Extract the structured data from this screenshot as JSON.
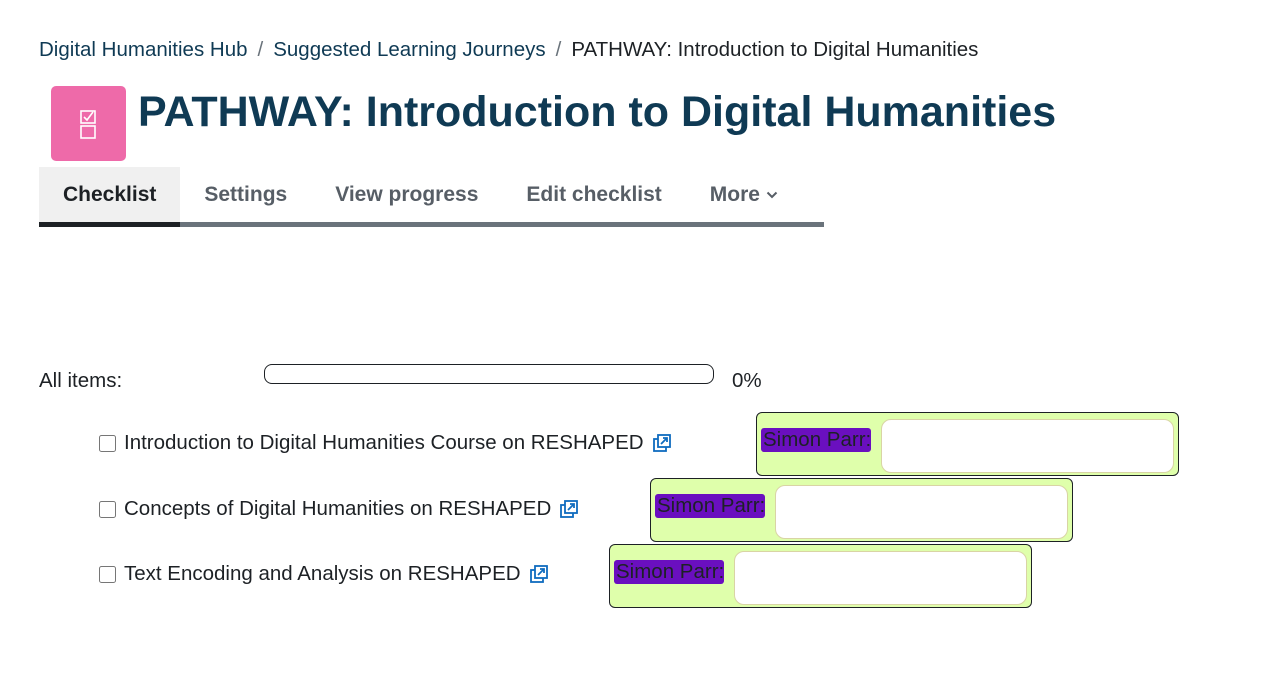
{
  "breadcrumb": {
    "items": [
      "Digital Humanities Hub",
      "Suggested Learning Journeys",
      "PATHWAY: Introduction to Digital Humanities"
    ],
    "separator": "/"
  },
  "header": {
    "title": "PATHWAY: Introduction to Digital Humanities",
    "icon": "checklist-icon",
    "icon_color": "#ee6aa9"
  },
  "tabs": [
    {
      "label": "Checklist",
      "active": true
    },
    {
      "label": "Settings"
    },
    {
      "label": "View progress"
    },
    {
      "label": "Edit checklist"
    },
    {
      "label": "More",
      "icon": "chevron-down-icon"
    }
  ],
  "progress": {
    "label": "All items:",
    "percent_text": "0%",
    "value": 0
  },
  "items": [
    {
      "label": "Introduction to Digital Humanities Course on RESHAPED",
      "checked": false,
      "commenter": "Simon Parr:",
      "comment": ""
    },
    {
      "label": "Concepts of Digital Humanities on RESHAPED",
      "checked": false,
      "commenter": "Simon Parr:",
      "comment": ""
    },
    {
      "label": "Text Encoding and Analysis on RESHAPED",
      "checked": false,
      "commenter": "Simon Parr:",
      "comment": ""
    }
  ],
  "colors": {
    "title": "#0f3a54",
    "comment_bg": "#dfffab",
    "highlight": "#6a0fbf"
  }
}
